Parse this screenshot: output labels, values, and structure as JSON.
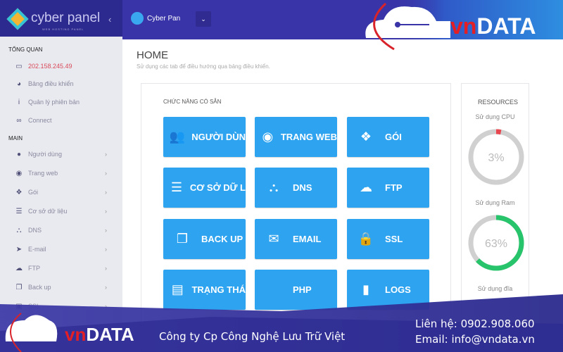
{
  "brand": {
    "name": "cyber panel",
    "tagline": "WEB HOSTING PANEL",
    "collapse_icon": "chevron-left"
  },
  "topbar": {
    "user": "Cyber Pan",
    "dropdown_icon": "chevron-down"
  },
  "sidebar": {
    "sections": [
      {
        "title": "TỔNG QUAN",
        "items": [
          {
            "label": "202.158.245.49",
            "icon": "laptop"
          },
          {
            "label": "Bảng điều khiển",
            "icon": "dashboard"
          },
          {
            "label": "Quản lý phiên bản",
            "icon": "info"
          },
          {
            "label": "Connect",
            "icon": "link"
          }
        ]
      },
      {
        "title": "MAIN",
        "items": [
          {
            "label": "Người dùng",
            "icon": "users"
          },
          {
            "label": "Trang web",
            "icon": "globe"
          },
          {
            "label": "Gói",
            "icon": "cubes"
          },
          {
            "label": "Cơ sở dữ liệu",
            "icon": "database"
          },
          {
            "label": "DNS",
            "icon": "sitemap"
          },
          {
            "label": "E-mail",
            "icon": "paper-plane"
          },
          {
            "label": "FTP",
            "icon": "cloud-upload"
          },
          {
            "label": "Back up",
            "icon": "copy"
          },
          {
            "label": "SSL",
            "icon": "lock"
          }
        ]
      }
    ]
  },
  "main": {
    "title": "HOME",
    "subtitle": "Sử dụng các tab để điều hướng qua bảng điều khiển.",
    "panel_title": "CHỨC NĂNG CÓ SẴN",
    "tiles": [
      {
        "label": "NGƯỜI DÙN",
        "icon": "users"
      },
      {
        "label": "TRANG WEB",
        "icon": "globe"
      },
      {
        "label": "GÓI",
        "icon": "cubes"
      },
      {
        "label": "CƠ SỞ DỮ L",
        "icon": "database"
      },
      {
        "label": "DNS",
        "icon": "sitemap"
      },
      {
        "label": "FTP",
        "icon": "cloud-upload"
      },
      {
        "label": "BACK UP",
        "icon": "copy"
      },
      {
        "label": "EMAIL",
        "icon": "envelope"
      },
      {
        "label": "SSL",
        "icon": "lock"
      },
      {
        "label": "TRẠNG THÁ",
        "icon": "server"
      },
      {
        "label": "PHP",
        "icon": "code"
      },
      {
        "label": "LOGS",
        "icon": "file"
      }
    ],
    "tile_color": "#2ea3f0"
  },
  "resources": {
    "title": "RESOURCES",
    "cpu": {
      "label": "Sử dụng CPU",
      "value": "3%",
      "percent": 3,
      "color": "#e8474f"
    },
    "ram": {
      "label": "Sử dụng Ram",
      "value": "63%",
      "percent": 63,
      "color": "#27c46b"
    },
    "disk": {
      "label": "Sử dụng đĩa"
    }
  },
  "watermark": {
    "logo": "vnDATA",
    "company": "Công ty Cp Công Nghệ Lưu Trữ Việt",
    "contact": "Liên hệ: 0902.908.060",
    "email": "Email: info@vndata.vn"
  }
}
